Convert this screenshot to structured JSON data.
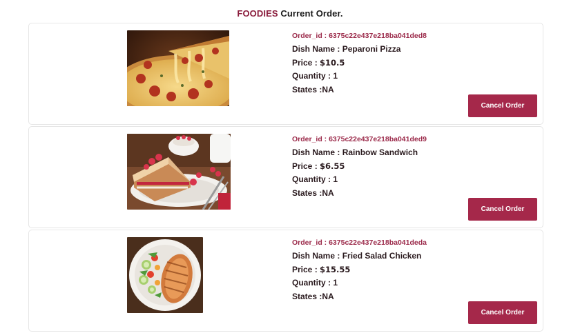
{
  "header": {
    "brand": "FOODIES",
    "title_rest": " Current Order."
  },
  "orders": [
    {
      "order_id_label": "Order_id : 6375c22e437e218ba041ded8",
      "dish_label": "Dish Name : ",
      "dish_name": "Peparoni Pizza",
      "price_label": "Price : ",
      "price": "$10.5",
      "quantity_label": "Quantity : ",
      "quantity": "1",
      "states_label": "States :",
      "states": "NA",
      "cancel_label": "Cancel Order",
      "image": "pepperoni-pizza-photo"
    },
    {
      "order_id_label": "Order_id : 6375c22e437e218ba041ded9",
      "dish_label": "Dish Name : ",
      "dish_name": "Rainbow Sandwich",
      "price_label": "Price : ",
      "price": "$6.55",
      "quantity_label": "Quantity : ",
      "quantity": "1",
      "states_label": "States :",
      "states": "NA",
      "cancel_label": "Cancel Order",
      "image": "raspberry-french-toast-photo"
    },
    {
      "order_id_label": "Order_id : 6375c22e437e218ba041deda",
      "dish_label": "Dish Name : ",
      "dish_name": "Fried Salad Chicken",
      "price_label": "Price : ",
      "price": "$15.55",
      "quantity_label": "Quantity : ",
      "quantity": "1",
      "states_label": "States :",
      "states": "NA",
      "cancel_label": "Cancel Order",
      "image": "grilled-chicken-salad-photo"
    }
  ],
  "colors": {
    "brand": "#8a1c3c",
    "order_id": "#9b2a4a",
    "button": "#a5284a",
    "card_border": "#e6e6e6"
  }
}
